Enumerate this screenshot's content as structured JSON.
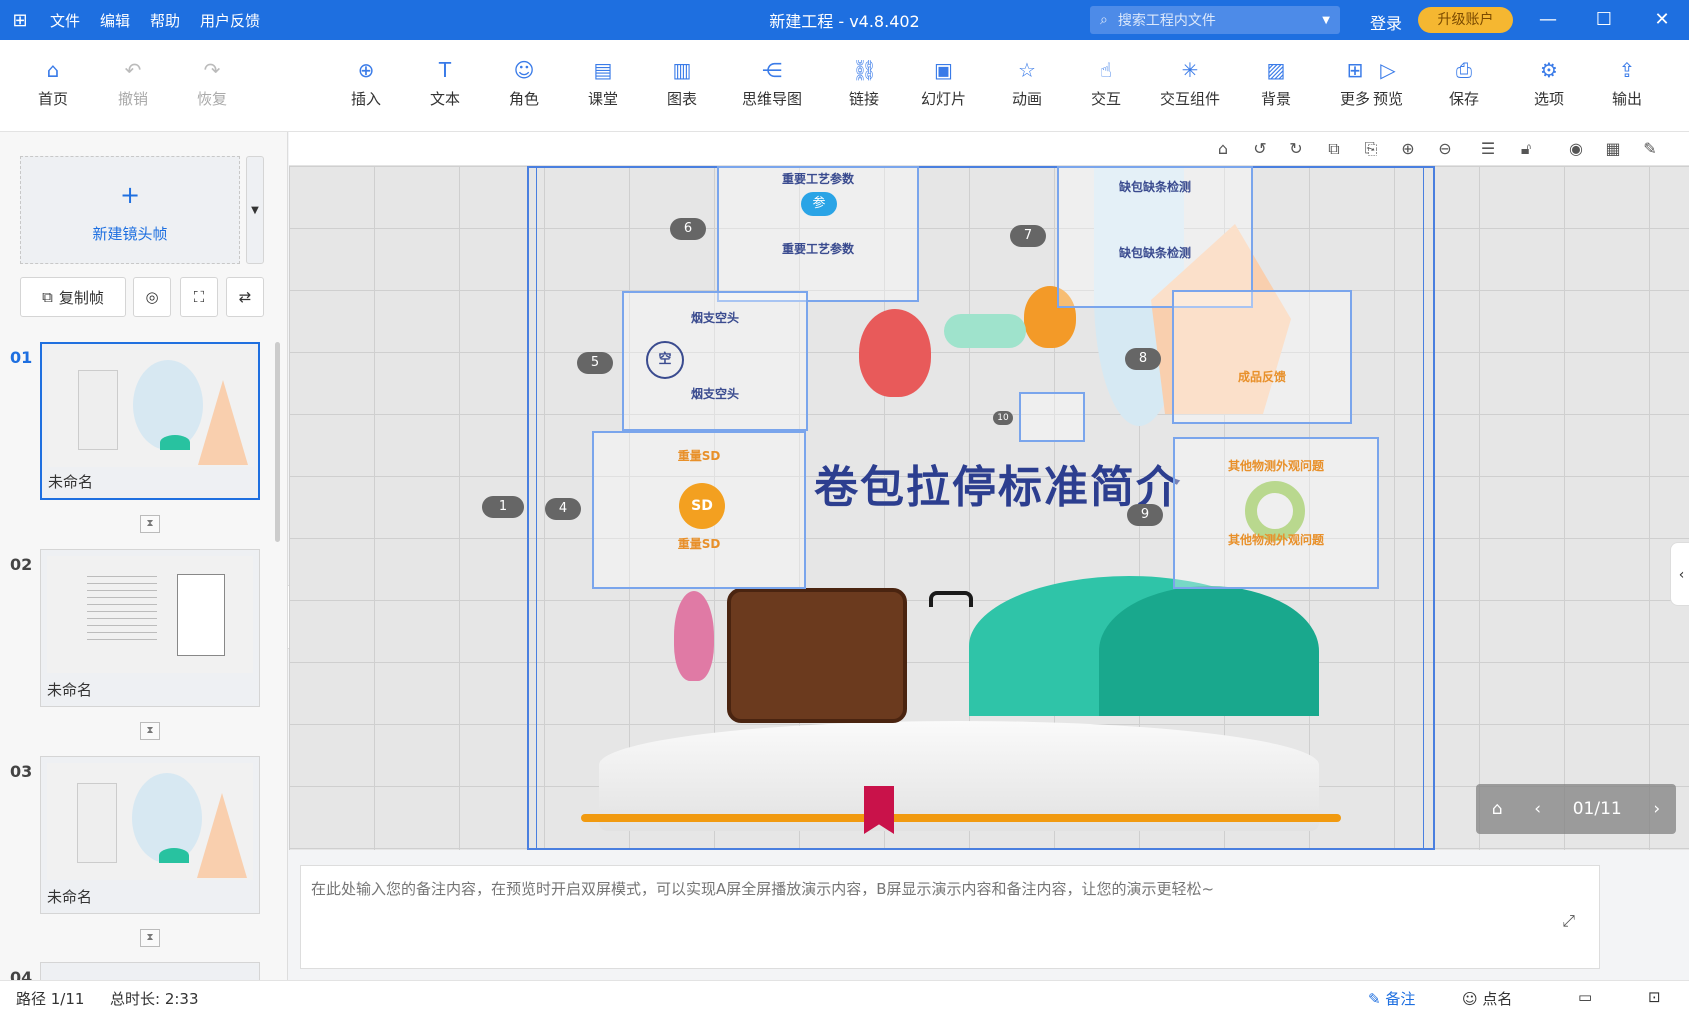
{
  "titlebar": {
    "menus": [
      "文件",
      "编辑",
      "帮助",
      "用户反馈"
    ],
    "title": "新建工程 - v4.8.402",
    "search_placeholder": "搜索工程内文件",
    "login": "登录",
    "upgrade": "升级账户"
  },
  "toolbar": {
    "home": "首页",
    "undo": "撤销",
    "redo": "恢复",
    "insert": "插入",
    "text": "文本",
    "role": "角色",
    "classroom": "课堂",
    "chart": "图表",
    "mindmap": "思维导图",
    "link": "链接",
    "slideshow": "幻灯片",
    "animation": "动画",
    "interaction": "交互",
    "interact_component": "交互组件",
    "background": "背景",
    "more": "更多",
    "preview": "预览",
    "save": "保存",
    "options": "选项",
    "export": "输出"
  },
  "left_panel": {
    "new_frame": "新建镜头帧",
    "copy_frame": "复制帧",
    "slides": [
      {
        "num": "01",
        "name": "未命名"
      },
      {
        "num": "02",
        "name": "未命名"
      },
      {
        "num": "03",
        "name": "未命名"
      },
      {
        "num": "04",
        "name": ""
      }
    ]
  },
  "canvas": {
    "main_title": "卷包拉停标准简介",
    "frames": [
      {
        "title": "重要工艺参数",
        "sub": "参",
        "num": "6"
      },
      {
        "title": "烟支空头",
        "sub": "空",
        "num": "5"
      },
      {
        "title": "重量SD",
        "sub": "SD",
        "num": "4"
      },
      {
        "title": "缺包缺条检测",
        "sub": "",
        "num": "7"
      },
      {
        "title": "成品反馈",
        "sub": "",
        "num": "8"
      },
      {
        "title": "其他物测外观问题",
        "sub": "",
        "num": "9"
      }
    ],
    "badge_1": "1",
    "badge_10": "10",
    "nav_page": "01/11"
  },
  "notes": {
    "placeholder": "在此处输入您的备注内容，在预览时开启双屏模式，可以实现A屏全屏播放演示内容，B屏显示演示内容和备注内容，让您的演示更轻松~"
  },
  "statusbar": {
    "path": "路径 1/11",
    "duration": "总时长: 2:33",
    "notes": "备注",
    "rollcall": "点名"
  }
}
